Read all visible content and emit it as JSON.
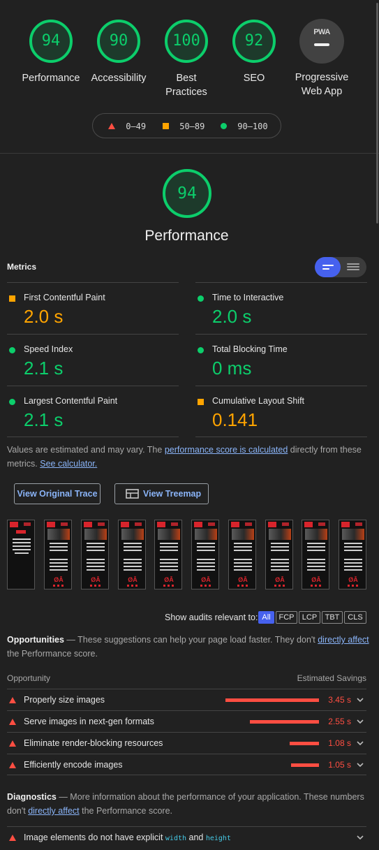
{
  "categories": [
    {
      "score": "94",
      "label": "Performance"
    },
    {
      "score": "90",
      "label": "Accessibility"
    },
    {
      "score": "100",
      "label": "Best Practices"
    },
    {
      "score": "92",
      "label": "SEO"
    },
    {
      "badge": "PWA",
      "label": "Progressive Web App"
    }
  ],
  "legend": {
    "fail": "0–49",
    "average": "50–89",
    "pass": "90–100"
  },
  "performance": {
    "score": "94",
    "title": "Performance"
  },
  "metrics": {
    "heading": "Metrics",
    "items": [
      {
        "name": "First Contentful Paint",
        "value": "2.0 s",
        "rating": "average"
      },
      {
        "name": "Time to Interactive",
        "value": "2.0 s",
        "rating": "pass"
      },
      {
        "name": "Speed Index",
        "value": "2.1 s",
        "rating": "pass"
      },
      {
        "name": "Total Blocking Time",
        "value": "0 ms",
        "rating": "pass"
      },
      {
        "name": "Largest Contentful Paint",
        "value": "2.1 s",
        "rating": "pass"
      },
      {
        "name": "Cumulative Layout Shift",
        "value": "0.141",
        "rating": "average"
      }
    ]
  },
  "note": {
    "text1": "Values are estimated and may vary. The ",
    "link1": "performance score is calculated",
    "text2": " directly from these metrics. ",
    "link2": "See calculator."
  },
  "buttons": {
    "trace": "View Original Trace",
    "treemap": "View Treemap"
  },
  "filter": {
    "label": "Show audits relevant to:",
    "chips": [
      "All",
      "FCP",
      "LCP",
      "TBT",
      "CLS"
    ]
  },
  "opportunities": {
    "title": "Opportunities",
    "desc1": " — These suggestions can help your page load faster. They don't ",
    "link": "directly affect",
    "desc2": " the Performance score.",
    "col_left": "Opportunity",
    "col_right": "Estimated Savings",
    "items": [
      {
        "title": "Properly size images",
        "savings": "3.45 s",
        "bar_fraction": 1.0
      },
      {
        "title": "Serve images in next-gen formats",
        "savings": "2.55 s",
        "bar_fraction": 0.74
      },
      {
        "title": "Eliminate render-blocking resources",
        "savings": "1.08 s",
        "bar_fraction": 0.31
      },
      {
        "title": "Efficiently encode images",
        "savings": "1.05 s",
        "bar_fraction": 0.3
      }
    ]
  },
  "diagnostics": {
    "title": "Diagnostics",
    "desc1": " — More information about the performance of your application. These numbers don't ",
    "link": "directly affect",
    "desc2": " the Performance score.",
    "item": {
      "prefix": "Image elements do not have explicit ",
      "code1": "width",
      "mid": " and ",
      "code2": "height"
    }
  },
  "colors": {
    "pass": "#0cce6b",
    "average": "#ffa400",
    "fail": "#ff4e42",
    "accent": "#4661ee"
  }
}
